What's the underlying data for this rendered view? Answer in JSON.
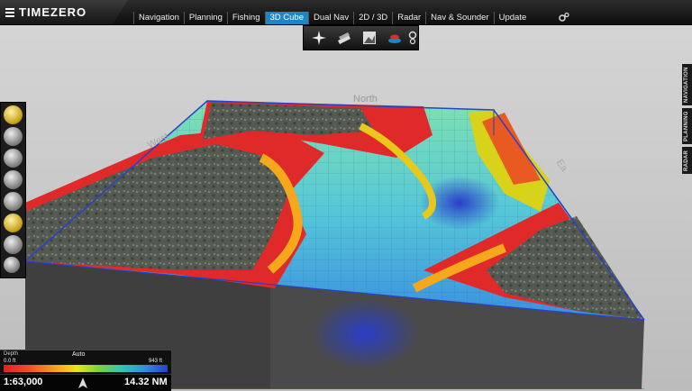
{
  "app": {
    "brand": "TIMEZERO"
  },
  "tabs": [
    {
      "label": "Navigation",
      "active": false
    },
    {
      "label": "Planning",
      "active": false
    },
    {
      "label": "Fishing",
      "active": false
    },
    {
      "label": "3D Cube",
      "active": true
    },
    {
      "label": "Dual Nav",
      "active": false
    },
    {
      "label": "2D / 3D",
      "active": false
    },
    {
      "label": "Radar",
      "active": false
    },
    {
      "label": "Nav & Sounder",
      "active": false
    },
    {
      "label": "Update",
      "active": false
    }
  ],
  "side_tabs": [
    "NAVIGATION",
    "PLANNING",
    "RADAR"
  ],
  "map": {
    "north_label": "North",
    "west_label": "West",
    "east_label": "Ea"
  },
  "depth_legend": {
    "title": "Depth",
    "mode": "Auto",
    "min": "0.0 ft",
    "max": "943 ft"
  },
  "status": {
    "scale": "1:63,000",
    "distance": "14.32 NM"
  },
  "colors": {
    "accent": "#1f86c3",
    "land_red": "#e0202a",
    "deep_blue": "#2a40c8"
  }
}
